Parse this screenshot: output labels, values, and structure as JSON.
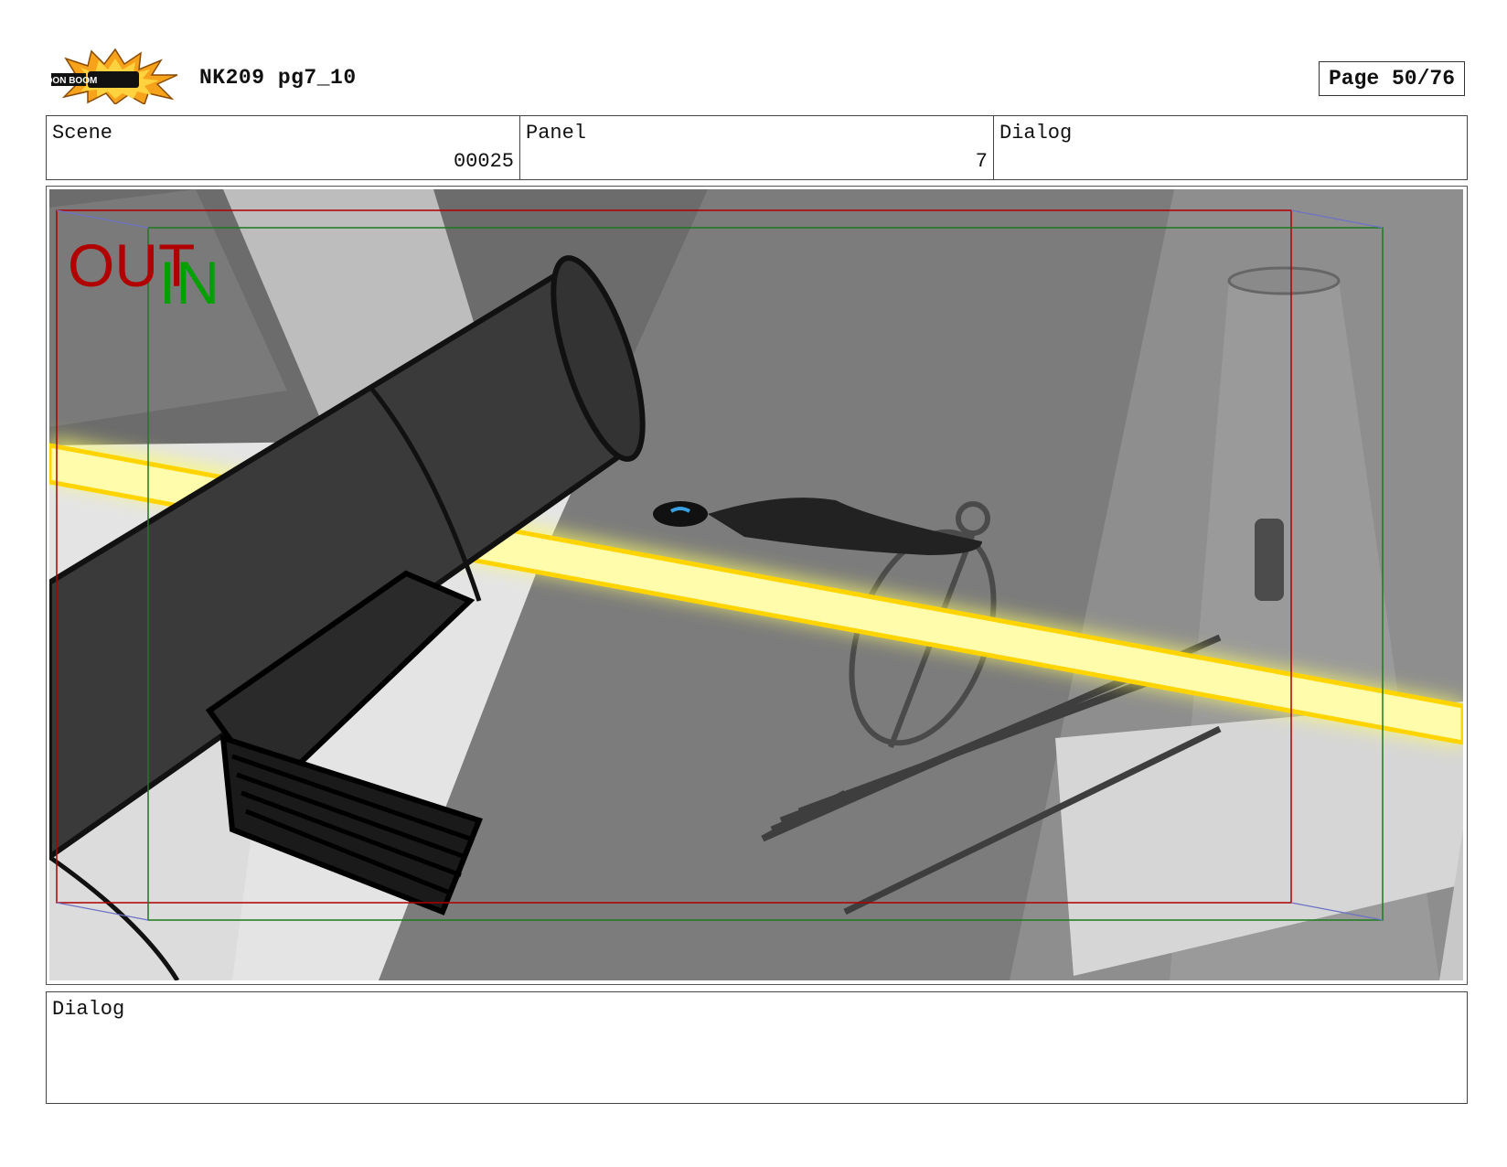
{
  "header": {
    "logo_text": "TOON BOOM",
    "title": "NK209 pg7_10",
    "page_label": "Page 50/76"
  },
  "info": {
    "scene_label": "Scene",
    "scene_value": "00025",
    "panel_label": "Panel",
    "panel_value": "7",
    "dialog_label": "Dialog"
  },
  "frame": {
    "out_label": "OUT",
    "in_label": "IN",
    "out_color": "#b00000",
    "in_color": "#00a000"
  },
  "dialog_box": {
    "label": "Dialog"
  }
}
